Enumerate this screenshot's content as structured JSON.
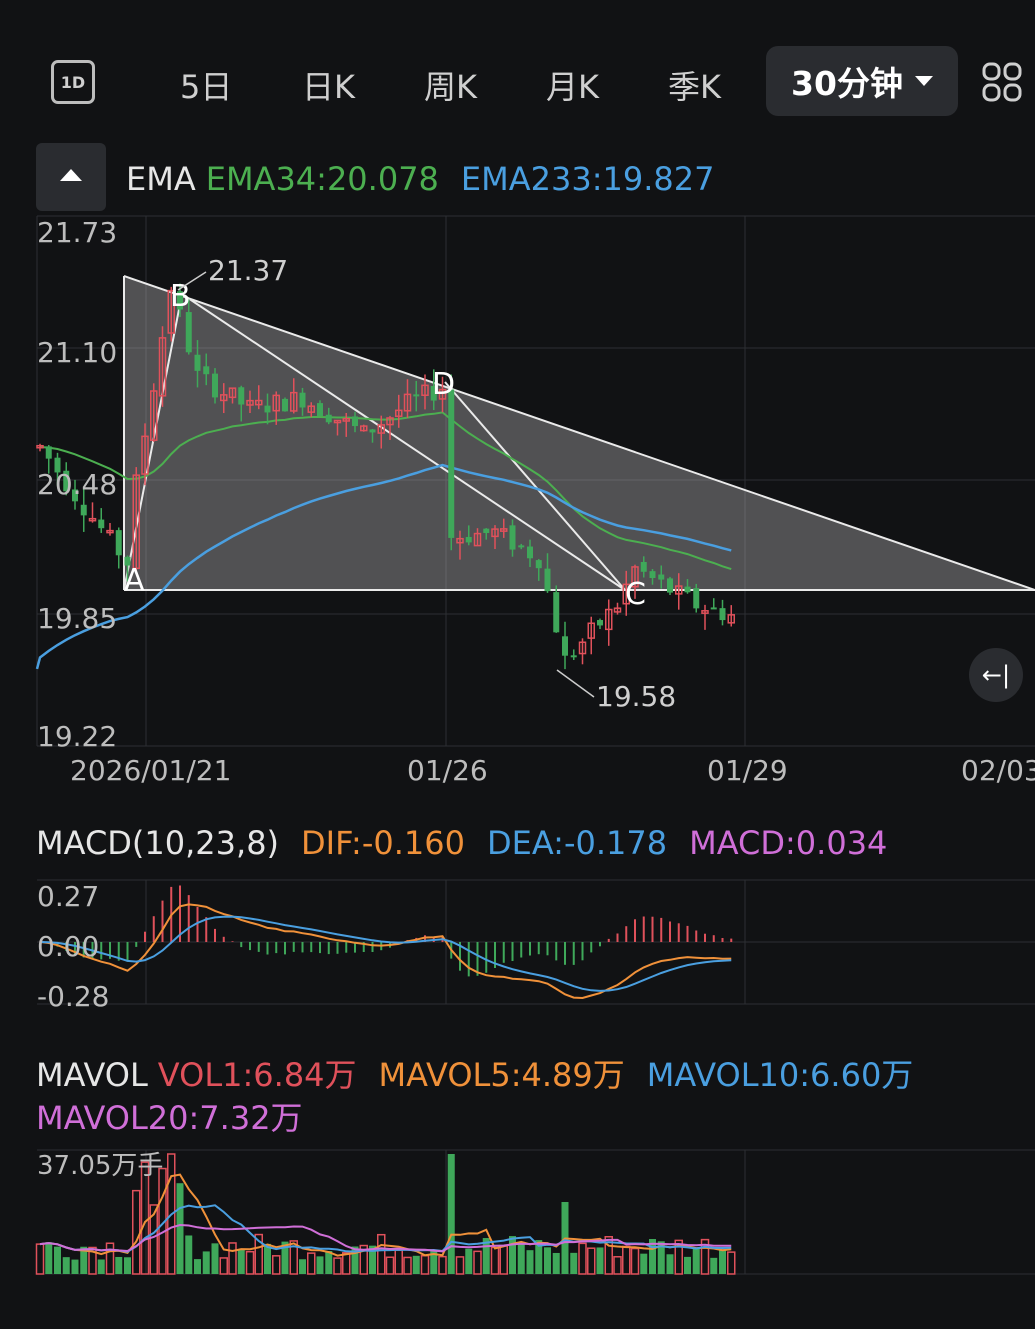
{
  "tabs": [
    {
      "label": "5日"
    },
    {
      "label": "日K"
    },
    {
      "label": "周K"
    },
    {
      "label": "月K"
    },
    {
      "label": "季K"
    }
  ],
  "active_tab": {
    "label": "30分钟"
  },
  "icon_1d": "1D",
  "icons": {
    "intraday": "1d-icon",
    "layout": "grid-icon",
    "collapse": "triangle-up-icon",
    "reset": "back-to-latest-icon"
  },
  "reset_label": "←|",
  "ema_legend": {
    "name": "EMA",
    "ema34": "EMA34:20.078",
    "ema233": "EMA233:19.827"
  },
  "macd_legend": {
    "name": "MACD(10,23,8)",
    "dif": "DIF:-0.160",
    "dea": "DEA:-0.178",
    "macd": "MACD:0.034"
  },
  "vol_legend": {
    "name": "MAVOL",
    "vol1": "VOL1:6.84万",
    "mavol5": "MAVOL5:4.89万",
    "mavol10": "MAVOL10:6.60万",
    "mavol20": "MAVOL20:7.32万"
  },
  "colors": {
    "up": "#e0515b",
    "down": "#3fa85a",
    "ema34": "#4caf50",
    "ema233": "#4a9fe0",
    "dif": "#f0913a",
    "dea": "#4a9fe0",
    "macd": "#d06fd8",
    "mavol20": "#d06fd8"
  },
  "chart_data": [
    {
      "type": "candlestick",
      "title": "EMA",
      "y_ticks": [
        "21.73",
        "21.10",
        "20.48",
        "19.85",
        "19.22"
      ],
      "x_ticks": [
        "2026/01/21",
        "01/26",
        "01/29",
        "02/03"
      ],
      "ylim": [
        19.22,
        21.73
      ],
      "annotations": {
        "high": "21.37",
        "low": "19.58",
        "points": [
          "A",
          "B",
          "C",
          "D"
        ]
      },
      "ema34_last": 20.078,
      "ema233_last": 19.827
    },
    {
      "type": "bar",
      "title": "MACD(10,23,8)",
      "y_ticks": [
        "0.27",
        "0.00",
        "-0.28"
      ],
      "series": [
        {
          "name": "DIF",
          "last": -0.16
        },
        {
          "name": "DEA",
          "last": -0.178
        },
        {
          "name": "MACD",
          "last": 0.034
        }
      ]
    },
    {
      "type": "bar",
      "title": "MAVOL",
      "y_ticks": [
        "37.05万手"
      ],
      "series": [
        {
          "name": "VOL1",
          "last": "6.84万"
        },
        {
          "name": "MAVOL5",
          "last": "4.89万"
        },
        {
          "name": "MAVOL10",
          "last": "6.60万"
        },
        {
          "name": "MAVOL20",
          "last": "7.32万"
        }
      ]
    }
  ]
}
